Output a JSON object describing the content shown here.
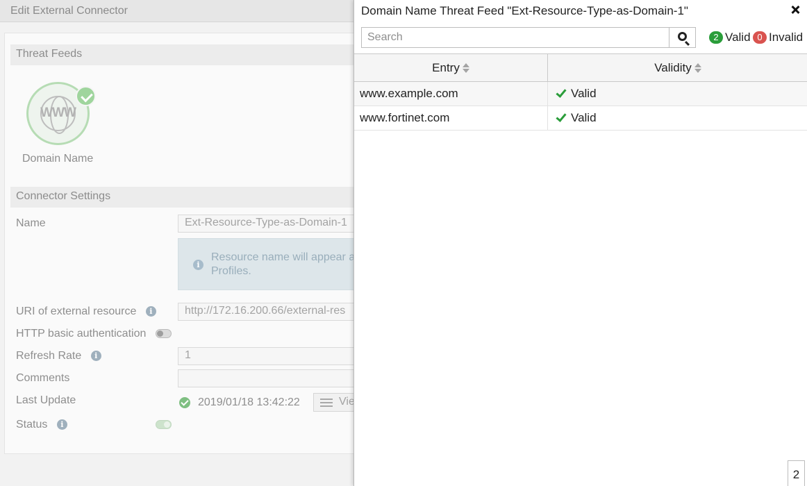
{
  "page": {
    "title": "Edit External Connector"
  },
  "threat_feeds": {
    "section_title": "Threat Feeds",
    "feed_type_label": "Domain Name",
    "feed_icon": "www-globe-icon",
    "selected_icon": "check-circle-icon"
  },
  "connector_settings": {
    "section_title": "Connector Settings",
    "name_label": "Name",
    "name_value": "Ext-Resource-Type-as-Domain-1",
    "info_text": "Resource name will appear a Profiles.",
    "uri_label": "URI of external resource",
    "uri_value": "http://172.16.200.66/external-res",
    "http_auth_label": "HTTP basic authentication",
    "http_auth_enabled": false,
    "refresh_rate_label": "Refresh Rate",
    "refresh_rate_value": "1",
    "comments_label": "Comments",
    "comments_value": "",
    "last_update_label": "Last Update",
    "last_update_value": "2019/01/18 13:42:22",
    "view_button_label": "Vie",
    "status_label": "Status",
    "status_enabled": true
  },
  "panel": {
    "title": "Domain Name Threat Feed \"Ext-Resource-Type-as-Domain-1\"",
    "search_placeholder": "Search",
    "valid_count": "2",
    "valid_label": "Valid",
    "invalid_count": "0",
    "invalid_label": "Invalid",
    "columns": [
      "Entry",
      "Validity"
    ],
    "rows": [
      {
        "entry": "www.example.com",
        "validity": "Valid"
      },
      {
        "entry": "www.fortinet.com",
        "validity": "Valid"
      }
    ],
    "page_number": "2"
  },
  "colors": {
    "valid_badge": "#2a9d3a",
    "invalid_badge": "#d9534f",
    "valid_check": "#2a9d3a"
  }
}
